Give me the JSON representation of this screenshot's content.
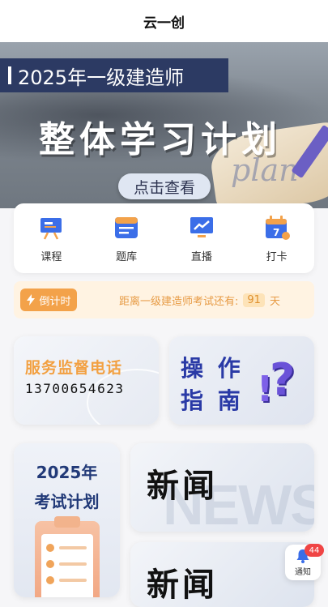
{
  "app": {
    "title": "云一创"
  },
  "banner": {
    "tag": "2025年一级建造师",
    "headline": "整体学习计划",
    "script_word": "plan",
    "cta": "点击查看"
  },
  "menu": {
    "items": [
      {
        "label": "课程",
        "icon": "presentation-board-icon"
      },
      {
        "label": "题库",
        "icon": "question-bank-icon"
      },
      {
        "label": "直播",
        "icon": "live-monitor-icon"
      },
      {
        "label": "打卡",
        "icon": "calendar-checkin-icon"
      }
    ],
    "calendar_day": "7"
  },
  "countdown": {
    "pill_label": "倒计时",
    "text": "距离一级建造师考试还有:",
    "days": "91",
    "unit": "天"
  },
  "cards": {
    "service": {
      "title": "服务监督电话",
      "phone": "13700654623"
    },
    "guide": {
      "line1": "操 作",
      "line2": "指 南"
    },
    "plan": {
      "year": "2025年",
      "label": "考试计划"
    },
    "news1": {
      "title": "新闻",
      "bg_text": "NEWS"
    },
    "news2": {
      "title": "新闻"
    }
  },
  "notification": {
    "label": "通知",
    "badge": "44"
  },
  "colors": {
    "accent_orange": "#f3a24a",
    "navy": "#2c3a63",
    "guide_blue": "#2a3aa6",
    "badge_red": "#f04545"
  }
}
